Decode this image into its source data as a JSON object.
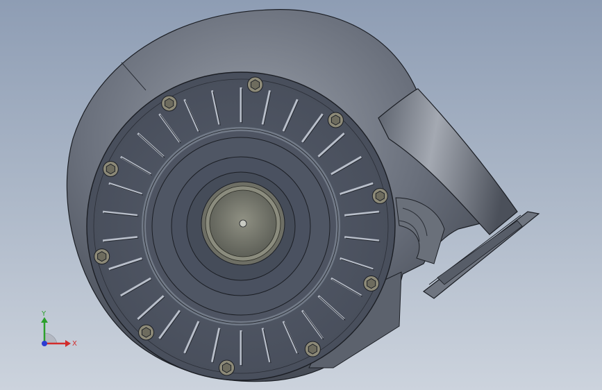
{
  "viewport": {
    "background_top": "#8e9db4",
    "background_bottom": "#ccd3dd",
    "model": {
      "name": "centrifugal-blower-housing",
      "body_color": "#5b6270",
      "face_color": "#4d5462",
      "edge_color": "#1b1e24",
      "bolt_count": 10,
      "vane_count": 30
    }
  },
  "triad": {
    "x_label": "X",
    "y_label": "Y",
    "x_color": "#d22c2c",
    "y_color": "#2ca02c",
    "z_color": "#2c3cd2"
  }
}
